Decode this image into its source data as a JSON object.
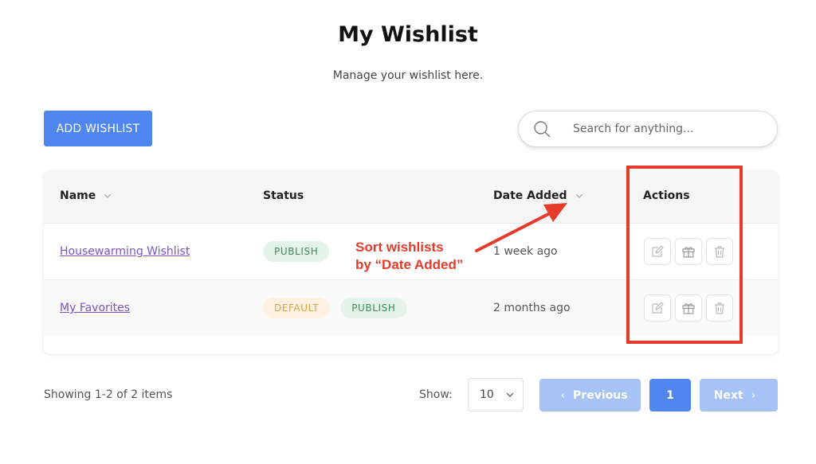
{
  "header": {
    "title": "My Wishlist",
    "subtitle": "Manage your wishlist here."
  },
  "toolbar": {
    "add_label": "ADD WISHLIST",
    "search_placeholder": "Search for anything..."
  },
  "table": {
    "columns": [
      "Name",
      "Status",
      "Date Added",
      "Actions"
    ],
    "rows": [
      {
        "name": "Housewarming Wishlist",
        "statuses": [
          "PUBLISH"
        ],
        "date_added": "1 week ago"
      },
      {
        "name": "My Favorites",
        "statuses": [
          "DEFAULT",
          "PUBLISH"
        ],
        "date_added": "2 months ago"
      }
    ]
  },
  "annotation": {
    "line1": "Sort wishlists",
    "line2": "by “Date Added”",
    "color": "#e53b2a"
  },
  "footer": {
    "showing": "Showing 1-2 of 2 items",
    "show_label": "Show:",
    "page_size": "10",
    "previous_label": "Previous",
    "current_page": "1",
    "next_label": "Next"
  },
  "icons": {
    "search": "search-icon",
    "sort": "chevron-down-icon",
    "edit": "edit-icon",
    "gift": "gift-icon",
    "delete": "trash-icon"
  },
  "colors": {
    "primary": "#4f86f0",
    "primary_light": "#a6c2f7",
    "link": "#7b52c9",
    "publish_bg": "#e5f4ea",
    "publish_text": "#3b8a57",
    "default_bg": "#fdf1df",
    "default_text": "#e0a34a"
  }
}
